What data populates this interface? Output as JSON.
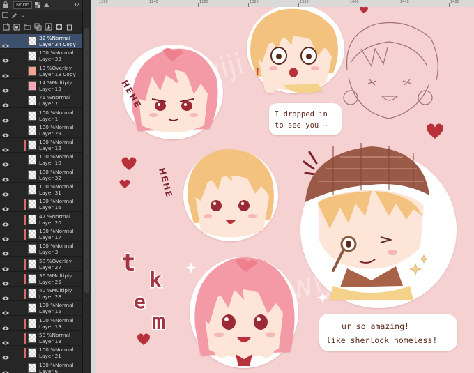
{
  "toolbar": {
    "blend_mode": "Norm",
    "opacity": "32"
  },
  "layers": [
    {
      "line1": "32 %Normal",
      "line2": "Layer 34 Copy",
      "selected": true,
      "clip": false,
      "thumb": "checker"
    },
    {
      "line1": "100 %Normal",
      "line2": "Layer 33",
      "selected": false,
      "clip": false,
      "thumb": "checker"
    },
    {
      "line1": "19 %Overlay",
      "line2": "Layer 13 Copy",
      "selected": false,
      "clip": false,
      "thumb": "salmon"
    },
    {
      "line1": "14 %Multiply",
      "line2": "Layer 13",
      "selected": false,
      "clip": false,
      "thumb": "pink"
    },
    {
      "line1": "71 %Normal",
      "line2": "Layer 7",
      "selected": false,
      "clip": false,
      "thumb": "checker"
    },
    {
      "line1": "100 %Normal",
      "line2": "Layer 1",
      "selected": false,
      "clip": false,
      "thumb": "checker"
    },
    {
      "line1": "100 %Normal",
      "line2": "Layer 29",
      "selected": false,
      "clip": false,
      "thumb": "checker"
    },
    {
      "line1": "100 %Normal",
      "line2": "Layer 12",
      "selected": false,
      "clip": true,
      "thumb": "checker"
    },
    {
      "line1": "100 %Normal",
      "line2": "Layer 10",
      "selected": false,
      "clip": false,
      "thumb": "checker"
    },
    {
      "line1": "100 %Normal",
      "line2": "Layer 32",
      "selected": false,
      "clip": false,
      "thumb": "checker"
    },
    {
      "line1": "100 %Normal",
      "line2": "Layer 31",
      "selected": false,
      "clip": false,
      "thumb": "checker"
    },
    {
      "line1": "100 %Normal",
      "line2": "Layer 16",
      "selected": false,
      "clip": true,
      "thumb": "checker"
    },
    {
      "line1": "47 %Normal",
      "line2": "Layer 20",
      "selected": false,
      "clip": true,
      "thumb": "checker"
    },
    {
      "line1": "100 %Normal",
      "line2": "Layer 17",
      "selected": false,
      "clip": true,
      "thumb": "checker"
    },
    {
      "line1": "100 %Normal",
      "line2": "Layer 3",
      "selected": false,
      "clip": false,
      "thumb": "checker"
    },
    {
      "line1": "58 %Overlay",
      "line2": "Layer 27",
      "selected": false,
      "clip": true,
      "thumb": "checker"
    },
    {
      "line1": "36 %Multiply",
      "line2": "Layer 25",
      "selected": false,
      "clip": true,
      "thumb": "checker"
    },
    {
      "line1": "40 %Multiply",
      "line2": "Layer 28",
      "selected": false,
      "clip": true,
      "thumb": "checker"
    },
    {
      "line1": "100 %Normal",
      "line2": "Layer 15",
      "selected": false,
      "clip": false,
      "thumb": "checker"
    },
    {
      "line1": "100 %Normal",
      "line2": "Layer 19",
      "selected": false,
      "clip": true,
      "thumb": "checker"
    },
    {
      "line1": "50 %Normal",
      "line2": "Layer 18",
      "selected": false,
      "clip": true,
      "thumb": "checker"
    },
    {
      "line1": "100 %Normal",
      "line2": "Layer 21",
      "selected": false,
      "clip": true,
      "thumb": "checker"
    },
    {
      "line1": "100 %Normal",
      "line2": "Layer 6",
      "selected": false,
      "clip": false,
      "thumb": "checker"
    }
  ],
  "ruler": {
    "ticks": [
      "1200",
      "1240",
      "1280",
      "1320",
      "1360",
      "1400",
      "1440",
      "1480"
    ]
  },
  "artwork": {
    "hehe_top": "HEHE",
    "hehe_mid": "HEHE",
    "bubble_top": [
      "I dropped in",
      "to see you ~"
    ],
    "bubble_bottom": [
      "ur so amazing!",
      "like sherlock homeless!"
    ],
    "tkem_letters": [
      "t",
      "k",
      "e",
      "m"
    ],
    "watermark": "wiji"
  },
  "colors": {
    "canvas_bg": "#f6d1d1",
    "hair_pink": "#f29aa6",
    "hair_blonde": "#f2c17d",
    "skin": "#fde6d8",
    "accent_red": "#b8303a",
    "deerstalker": "#9a5a47",
    "panel_bg": "#262626",
    "selected_layer": "#3c4f6c"
  }
}
